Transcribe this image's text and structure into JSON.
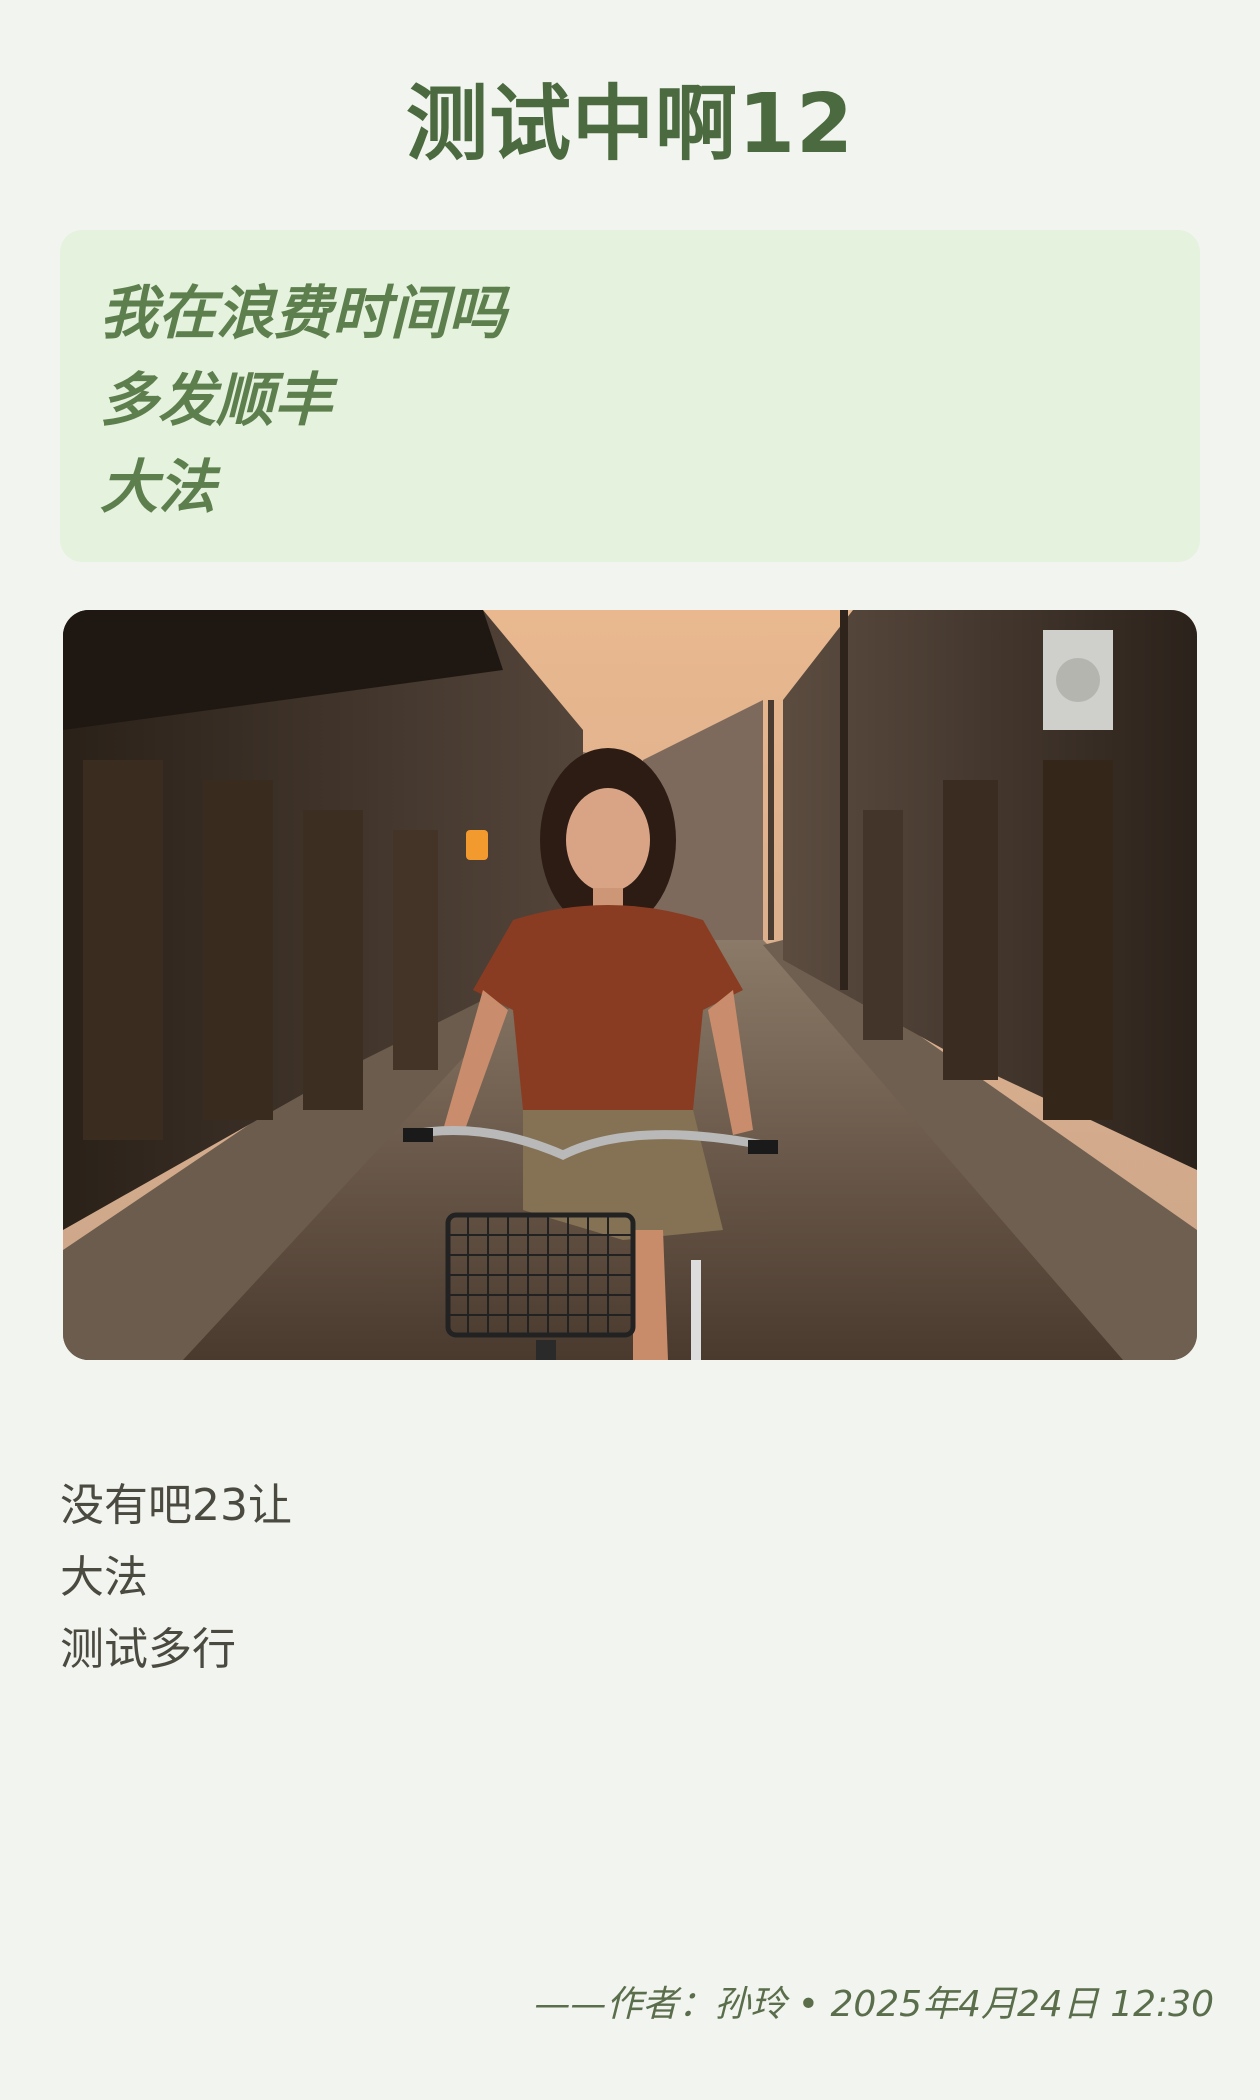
{
  "title": "测试中啊12",
  "quote": {
    "lines": [
      "我在浪费时间吗",
      "多发顺丰",
      "大法"
    ]
  },
  "image": {
    "subject": "woman-riding-bicycle-old-street"
  },
  "body": {
    "lines": [
      "没有吧23让",
      "大法",
      "测试多行"
    ]
  },
  "footer": {
    "prefix": "——作者：",
    "author": "孙玲",
    "separator": " • ",
    "datetime": "2025年4月24日 12:30"
  },
  "colors": {
    "background": "#f2f5ef",
    "title": "#4c6a3f",
    "quote_bg": "#e5f2de",
    "quote_text": "#5d7f4d",
    "body_text": "#4a4a40"
  }
}
